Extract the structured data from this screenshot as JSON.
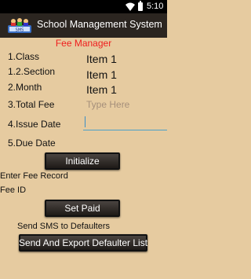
{
  "status": {
    "time": "5:10"
  },
  "app": {
    "title": "School Management System",
    "icon_text": "SMS"
  },
  "form": {
    "title": "Fee Manager",
    "rows": [
      {
        "label": "1.Class",
        "value": "Item 1"
      },
      {
        "label": "1.2.Section",
        "value": "Item 1"
      },
      {
        "label": "2.Month",
        "value": "Item 1"
      }
    ],
    "total_fee": {
      "label": "3.Total Fee",
      "placeholder": "Type Here"
    },
    "issue_date": {
      "label": "4.Issue Date",
      "value": ""
    },
    "due_date": {
      "label": "5.Due Date"
    }
  },
  "buttons": {
    "initialize": "Initialize",
    "set_paid": "Set Paid",
    "send_export": "Send And Export Defaulter List"
  },
  "fee_record": {
    "enter_label": "Enter Fee Record",
    "id_label": "Fee ID"
  },
  "sms": {
    "label": "Send SMS to Defaulters"
  },
  "colors": {
    "background": "#e6cba0",
    "title": "#ef1d1d",
    "action_bar": "#2b2520",
    "accent": "#4aa0c8"
  },
  "icons": {
    "wifi": "wifi-icon",
    "battery": "battery-icon",
    "app": "app-icon"
  }
}
